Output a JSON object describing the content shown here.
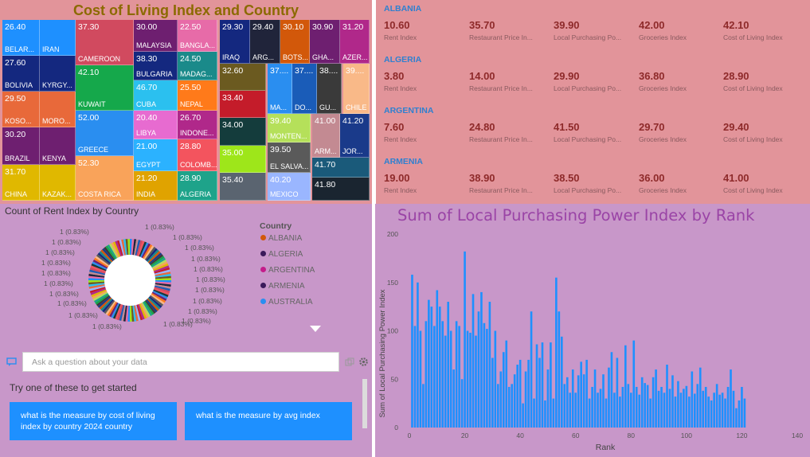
{
  "treemap": {
    "title": "Cost of Living Index and Country",
    "cells": [
      {
        "value": "26.40",
        "name": "BELAR...",
        "color": "#1e90ff"
      },
      {
        "value": "",
        "name": "IRAN",
        "color": "#1e90ff"
      },
      {
        "value": "27.60",
        "name": "BOLIVIA",
        "color": "#14287f"
      },
      {
        "value": "",
        "name": "KYRGY...",
        "color": "#14287f"
      },
      {
        "value": "29.50",
        "name": "KOSO...",
        "color": "#e8693a"
      },
      {
        "value": "",
        "name": "MORO...",
        "color": "#e8693a"
      },
      {
        "value": "30.20",
        "name": "BRAZIL",
        "color": "#6e1f70"
      },
      {
        "value": "",
        "name": "KENYA",
        "color": "#6e1f70"
      },
      {
        "value": "31.70",
        "name": "CHINA",
        "color": "#e0b800"
      },
      {
        "value": "",
        "name": "KAZAK...",
        "color": "#e0b800"
      },
      {
        "value": "37.30",
        "name": "CAMEROON",
        "color": "#d14a5f"
      },
      {
        "value": "42.10",
        "name": "KUWAIT",
        "color": "#15a84b"
      },
      {
        "value": "52.00",
        "name": "GREECE",
        "color": "#2a8ef0"
      },
      {
        "value": "52.30",
        "name": "COSTA RICA",
        "color": "#f9a35a"
      },
      {
        "value": "30.00",
        "name": "MALAYSIA",
        "color": "#6e1f70"
      },
      {
        "value": "22.50",
        "name": "BANGLA...",
        "color": "#e76ba8"
      },
      {
        "value": "38.30",
        "name": "BULGARIA",
        "color": "#14287f"
      },
      {
        "value": "24.50",
        "name": "MADAG...",
        "color": "#1a8a8a"
      },
      {
        "value": "46.70",
        "name": "CUBA",
        "color": "#2bc0ef"
      },
      {
        "value": "25.50",
        "name": "NEPAL",
        "color": "#ff7a1a"
      },
      {
        "value": "20.40",
        "name": "LIBYA",
        "color": "#e76bd0"
      },
      {
        "value": "26.70",
        "name": "INDONE...",
        "color": "#b0288a"
      },
      {
        "value": "21.00",
        "name": "EGYPT",
        "color": "#2bb2ff"
      },
      {
        "value": "28.80",
        "name": "COLOMB...",
        "color": "#f3545e"
      },
      {
        "value": "21.20",
        "name": "INDIA",
        "color": "#e0a300"
      },
      {
        "value": "28.90",
        "name": "ALGERIA",
        "color": "#1ea38a"
      },
      {
        "value": "29.30",
        "name": "IRAQ",
        "color": "#14287f"
      },
      {
        "value": "29.40",
        "name": "ARG...",
        "color": "#20243a"
      },
      {
        "value": "30.10",
        "name": "BOTS...",
        "color": "#d2580a"
      },
      {
        "value": "30.90",
        "name": "GHA...",
        "color": "#6e1f70"
      },
      {
        "value": "31.20",
        "name": "AZER...",
        "color": "#b0288a"
      },
      {
        "value": "32.60",
        "name": "",
        "color": "#6b5a20"
      },
      {
        "value": "37....",
        "name": "MA...",
        "color": "#2a8ef0"
      },
      {
        "value": "37....",
        "name": "DO...",
        "color": "#1a5cb8"
      },
      {
        "value": "38....",
        "name": "GU...",
        "color": "#3a3a3a"
      },
      {
        "value": "39....",
        "name": "CHILE",
        "color": "#f9b988"
      },
      {
        "value": "33.40",
        "name": "",
        "color": "#c41c2a"
      },
      {
        "value": "34.00",
        "name": "",
        "color": "#143c3c"
      },
      {
        "value": "39.40",
        "name": "MONTEN...",
        "color": "#b5e05a"
      },
      {
        "value": "41.00",
        "name": "ARM...",
        "color": "#c38a92"
      },
      {
        "value": "41.20",
        "name": "JOR...",
        "color": "#1a3a8a"
      },
      {
        "value": "35.00",
        "name": "",
        "color": "#9ee61a"
      },
      {
        "value": "39.50",
        "name": "EL SALVA...",
        "color": "#5a5a5a"
      },
      {
        "value": "41.70",
        "name": "",
        "color": "#1a5a7a"
      },
      {
        "value": "35.40",
        "name": "",
        "color": "#5a6470"
      },
      {
        "value": "40.20",
        "name": "MEXICO",
        "color": "#9ab6ff"
      },
      {
        "value": "41.80",
        "name": "",
        "color": "#1a2530"
      }
    ]
  },
  "multirow": {
    "labels": [
      "Rent Index",
      "Restaurant Price In...",
      "Local Purchasing Po...",
      "Groceries Index",
      "Cost of Living Index"
    ],
    "rows": [
      {
        "country": "ALBANIA",
        "values": [
          "10.60",
          "35.70",
          "39.90",
          "42.00",
          "42.10"
        ]
      },
      {
        "country": "ALGERIA",
        "values": [
          "3.80",
          "14.00",
          "29.90",
          "36.80",
          "28.90"
        ]
      },
      {
        "country": "ARGENTINA",
        "values": [
          "7.60",
          "24.80",
          "41.50",
          "29.70",
          "29.40"
        ]
      },
      {
        "country": "ARMENIA",
        "values": [
          "19.00",
          "38.90",
          "38.50",
          "36.00",
          "41.00"
        ]
      }
    ]
  },
  "donut": {
    "title": "Count of Rent Index by Country",
    "slice_label": "1 (0.83%)",
    "legend_title": "Country",
    "legend": [
      {
        "name": "ALBANIA",
        "color": "#d2580a"
      },
      {
        "name": "ALGERIA",
        "color": "#3a1a5a"
      },
      {
        "name": "ARGENTINA",
        "color": "#c41c8a"
      },
      {
        "name": "ARMENIA",
        "color": "#3a1a5a"
      },
      {
        "name": "AUSTRALIA",
        "color": "#2a8ef0"
      }
    ],
    "slice_colors": [
      "#1e90ff",
      "#14287f",
      "#e8693a",
      "#6e1f70",
      "#e0b800",
      "#d14a5f",
      "#15a84b",
      "#e76ba8",
      "#1a8a8a",
      "#2bc0ef",
      "#ff7a1a",
      "#b0288a",
      "#f3545e",
      "#1ea38a",
      "#20243a",
      "#d2580a",
      "#6b5a20",
      "#f9b988",
      "#c41c2a",
      "#143c3c",
      "#b5e05a",
      "#c38a92",
      "#1a3a8a",
      "#9ee61a",
      "#5a5a5a",
      "#9ab6ff",
      "#2a8ef0",
      "#f9a35a",
      "#1a5cb8",
      "#3a3a3a"
    ]
  },
  "qa": {
    "placeholder": "Ask a question about your data",
    "try_text": "Try one of these to get started",
    "suggestions": [
      "what is the measure by cost of living index by country 2024 country",
      "what is the measure by avg index"
    ]
  },
  "chart_data": {
    "type": "bar",
    "title": "Sum of Local Purchasing Power Index by Rank",
    "xlabel": "Rank",
    "ylabel": "Sum of Local Purchasing Power Index",
    "xlim": [
      0,
      140
    ],
    "ylim": [
      0,
      200
    ],
    "x_ticks": [
      "0",
      "20",
      "40",
      "60",
      "80",
      "100",
      "120",
      "140"
    ],
    "y_ticks": [
      "0",
      "50",
      "100",
      "150",
      "200"
    ],
    "bar_color": "#1e90ff",
    "x": [
      1,
      2,
      3,
      4,
      5,
      6,
      7,
      8,
      9,
      10,
      11,
      12,
      13,
      14,
      15,
      16,
      17,
      18,
      19,
      20,
      21,
      22,
      23,
      24,
      25,
      26,
      27,
      28,
      29,
      30,
      31,
      32,
      33,
      34,
      35,
      36,
      37,
      38,
      39,
      40,
      41,
      42,
      43,
      44,
      45,
      46,
      47,
      48,
      49,
      50,
      51,
      52,
      53,
      54,
      55,
      56,
      57,
      58,
      59,
      60,
      61,
      62,
      63,
      64,
      65,
      66,
      67,
      68,
      69,
      70,
      71,
      72,
      73,
      74,
      75,
      76,
      77,
      78,
      79,
      80,
      81,
      82,
      83,
      84,
      85,
      86,
      87,
      88,
      89,
      90,
      91,
      92,
      93,
      94,
      95,
      96,
      97,
      98,
      99,
      100,
      101,
      102,
      103,
      104,
      105,
      106,
      107,
      108,
      109,
      110,
      111,
      112,
      113,
      114,
      115,
      116,
      117,
      118,
      119,
      120,
      121
    ],
    "values": [
      158,
      105,
      150,
      100,
      45,
      110,
      132,
      125,
      105,
      142,
      125,
      110,
      95,
      130,
      100,
      60,
      110,
      105,
      50,
      182,
      100,
      98,
      138,
      95,
      120,
      140,
      108,
      102,
      130,
      72,
      100,
      45,
      58,
      78,
      90,
      42,
      45,
      55,
      65,
      70,
      25,
      58,
      70,
      120,
      30,
      86,
      72,
      88,
      28,
      60,
      88,
      30,
      155,
      120,
      94,
      45,
      52,
      36,
      60,
      36,
      54,
      68,
      55,
      70,
      30,
      42,
      60,
      36,
      40,
      55,
      30,
      62,
      78,
      36,
      72,
      32,
      42,
      85,
      45,
      36,
      90,
      42,
      34,
      52,
      46,
      44,
      30,
      52,
      60,
      38,
      42,
      36,
      65,
      40,
      54,
      32,
      48,
      36,
      40,
      43,
      32,
      58,
      35,
      45,
      62,
      38,
      42,
      32,
      28,
      36,
      45,
      34,
      36,
      30,
      42,
      60,
      38,
      20,
      28,
      42,
      30
    ]
  }
}
